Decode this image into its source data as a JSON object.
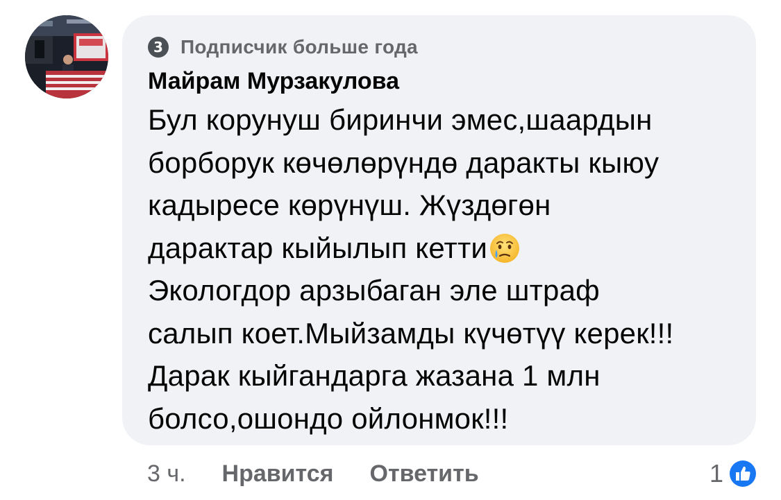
{
  "badge": {
    "level": "3",
    "label": "Подписчик больше года"
  },
  "comment": {
    "author": "Майрам Мурзакулова",
    "text_before_emoji": "Бул корунуш биринчи эмес,шаардын\nборборук көчөлөрүндө даракты кыюу\nкадыресе көрүнүш. Жүздөгөн\nдарактар кыйылып кетти",
    "emoji": "crying-face-emoji",
    "text_after_emoji": "\nЭкологдор арзыбаган  эле штраф\nсалып коет.Мыйзамды күчөтүү керек!!!\nДарак кыйгандарга жазана 1 млн\nболсо,ошондо ойлонмок!!!"
  },
  "actions": {
    "time": "3 ч.",
    "like_label": "Нравится",
    "reply_label": "Ответить",
    "reaction_count": "1"
  },
  "colors": {
    "bubble_bg": "#f0f2f5",
    "secondary_text": "#65676b",
    "like_blue": "#1877f2"
  },
  "icons": {
    "avatar": "avatar-tv-studio",
    "reaction": "like-icon"
  }
}
